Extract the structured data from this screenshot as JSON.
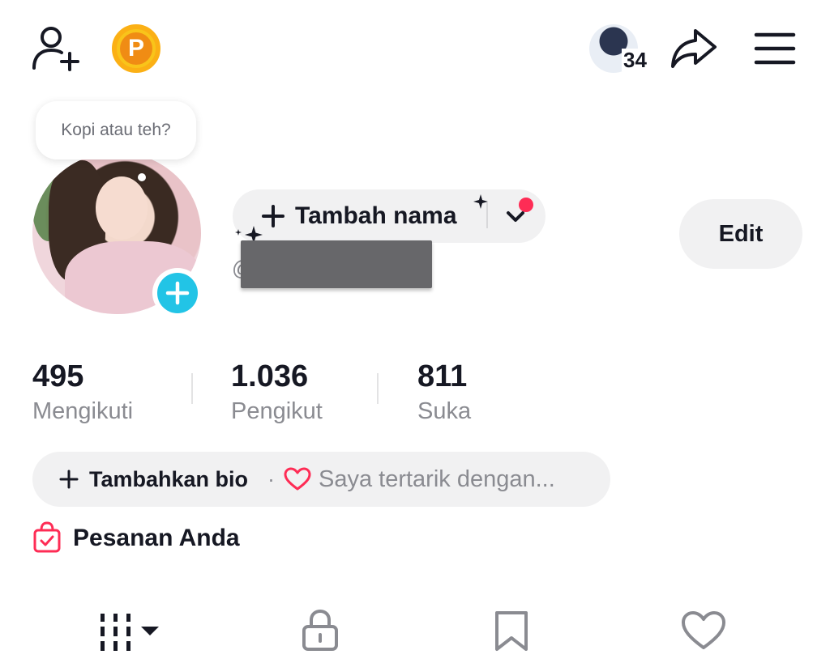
{
  "header": {
    "visitor_count": "34",
    "coin_letter": "P"
  },
  "profile": {
    "tooltip": "Kopi atau teh?",
    "add_name_label": "Tambah nama",
    "username_prefix": "@",
    "edit_label": "Edit"
  },
  "stats": [
    {
      "value": "495",
      "label": "Mengikuti"
    },
    {
      "value": "1.036",
      "label": "Pengikut"
    },
    {
      "value": "811",
      "label": "Suka"
    }
  ],
  "bio": {
    "add_label": "Tambahkan bio",
    "separator": "·",
    "interest_label": "Saya tertarik dengan..."
  },
  "orders": {
    "label": "Pesanan Anda"
  },
  "colors": {
    "accent_red": "#fe2c55",
    "avatar_add_blue": "#22c4e6",
    "coin_gold": "#f9c41a"
  }
}
